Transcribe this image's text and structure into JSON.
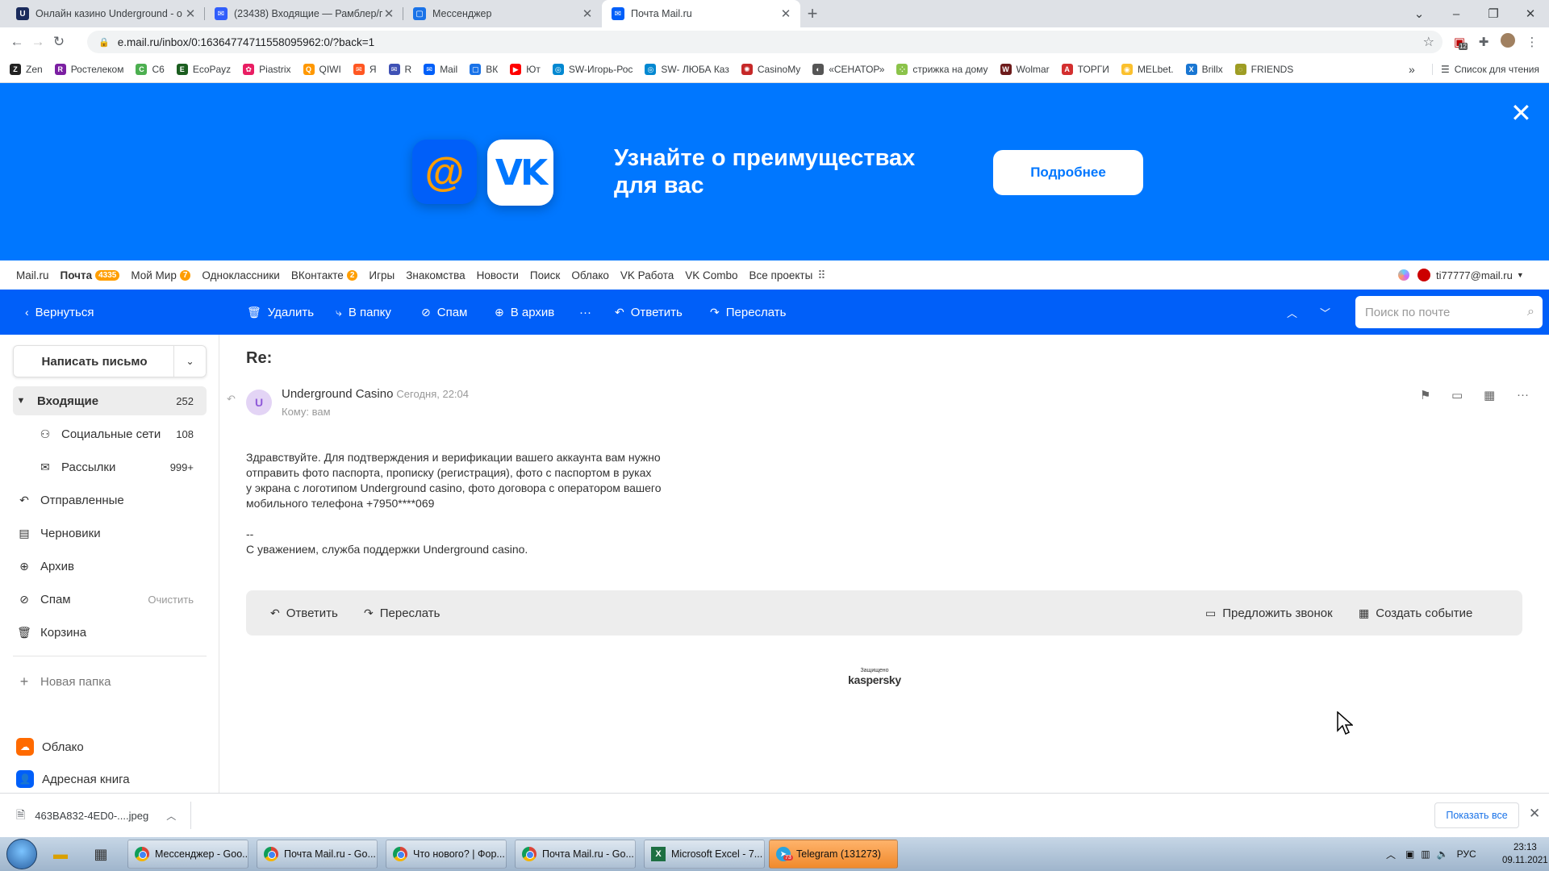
{
  "browser": {
    "tabs": [
      {
        "title": "Онлайн казино Underground - о",
        "color": "#1a2b5c"
      },
      {
        "title": "(23438) Входящие — Рамблер/п",
        "color": "#315efb"
      },
      {
        "title": "Мессенджер",
        "color": "#1a73e8"
      },
      {
        "title": "Почта Mail.ru",
        "color": "#005ff9"
      }
    ],
    "url": "e.mail.ru/inbox/0:16364774711558095962:0/?back=1",
    "ext_badge": "12"
  },
  "bookmarks": [
    "Zen",
    "Ростелеком",
    "C6",
    "EcoPayz",
    "Piastrix",
    "QIWI",
    "Я",
    "R",
    "Mail",
    "ВК",
    "Ют",
    "SW-Игорь-Рос",
    "SW- ЛЮБА Каз",
    "CasinoMy",
    "«СЕНАТОР»",
    "стрижка на дому",
    "Wolmar",
    "ТОРГИ",
    "MELbet.",
    "Brillx",
    "FRIENDS"
  ],
  "bookmarks_more": "»",
  "reading_list": "Список для чтения",
  "banner": {
    "title": "Узнайте о преимуществах для вас",
    "button": "Подробнее"
  },
  "portal": {
    "mailru": "Mail.ru",
    "pochta": "Почта",
    "pochta_count": "4335",
    "moimir": "Мой Мир",
    "moimir_count": "7",
    "ok": "Одноклассники",
    "vk": "ВКонтакте",
    "vk_count": "2",
    "games": "Игры",
    "dating": "Знакомства",
    "news": "Новости",
    "search": "Поиск",
    "cloud": "Облако",
    "vkwork": "VK Работа",
    "vkcombo": "VK Combo",
    "all": "Все проекты",
    "user": "ti77777@mail.ru"
  },
  "toolbar": {
    "back": "Вернуться",
    "delete": "Удалить",
    "tofolder": "В папку",
    "spam": "Спам",
    "archive": "В архив",
    "more": "···",
    "reply": "Ответить",
    "forward": "Переслать",
    "search_placeholder": "Поиск по почте"
  },
  "sidebar": {
    "compose": "Написать письмо",
    "folders": {
      "inbox": {
        "label": "Входящие",
        "count": "252"
      },
      "social": {
        "label": "Социальные сети",
        "count": "108"
      },
      "newsletters": {
        "label": "Рассылки",
        "count": "999+"
      },
      "sent": {
        "label": "Отправленные"
      },
      "drafts": {
        "label": "Черновики"
      },
      "archive": {
        "label": "Архив"
      },
      "spam": {
        "label": "Спам",
        "action": "Очистить"
      },
      "trash": {
        "label": "Корзина"
      }
    },
    "new_folder": "Новая папка",
    "cloud": "Облако",
    "addressbook": "Адресная книга"
  },
  "letter": {
    "subject": "Re:",
    "avatar_letter": "U",
    "sender": "Underground Casino",
    "date": "Сегодня, 22:04",
    "to": "Кому: вам",
    "body": "Здравствуйте. Для подтверждения и верификации вашего аккаунта вам нужно\nотправить фото паспорта, прописку (регистрация), фото с паспортом в руках\nу экрана с логотипом Underground casino, фото договора с оператором вашего\nмобильного телефона +7950****069\n\n--\nС уважением, служба поддержки Underground casino.",
    "reply": "Ответить",
    "forward": "Переслать",
    "suggest_call": "Предложить звонок",
    "create_event": "Создать событие",
    "protected": "Защищено",
    "kaspersky": "kaspersky"
  },
  "download": {
    "file": "463BA832-4ED0-....jpeg",
    "show_all": "Показать все"
  },
  "taskbar": {
    "items": [
      "Мессенджер - Goo...",
      "Почта Mail.ru - Go...",
      "Что нового? | Фор...",
      "Почта Mail.ru - Go...",
      "Microsoft Excel - 7...",
      "Telegram (131273)"
    ],
    "telegram_badge": "73",
    "lang": "РУС",
    "time": "23:13",
    "date": "09.11.2021"
  }
}
